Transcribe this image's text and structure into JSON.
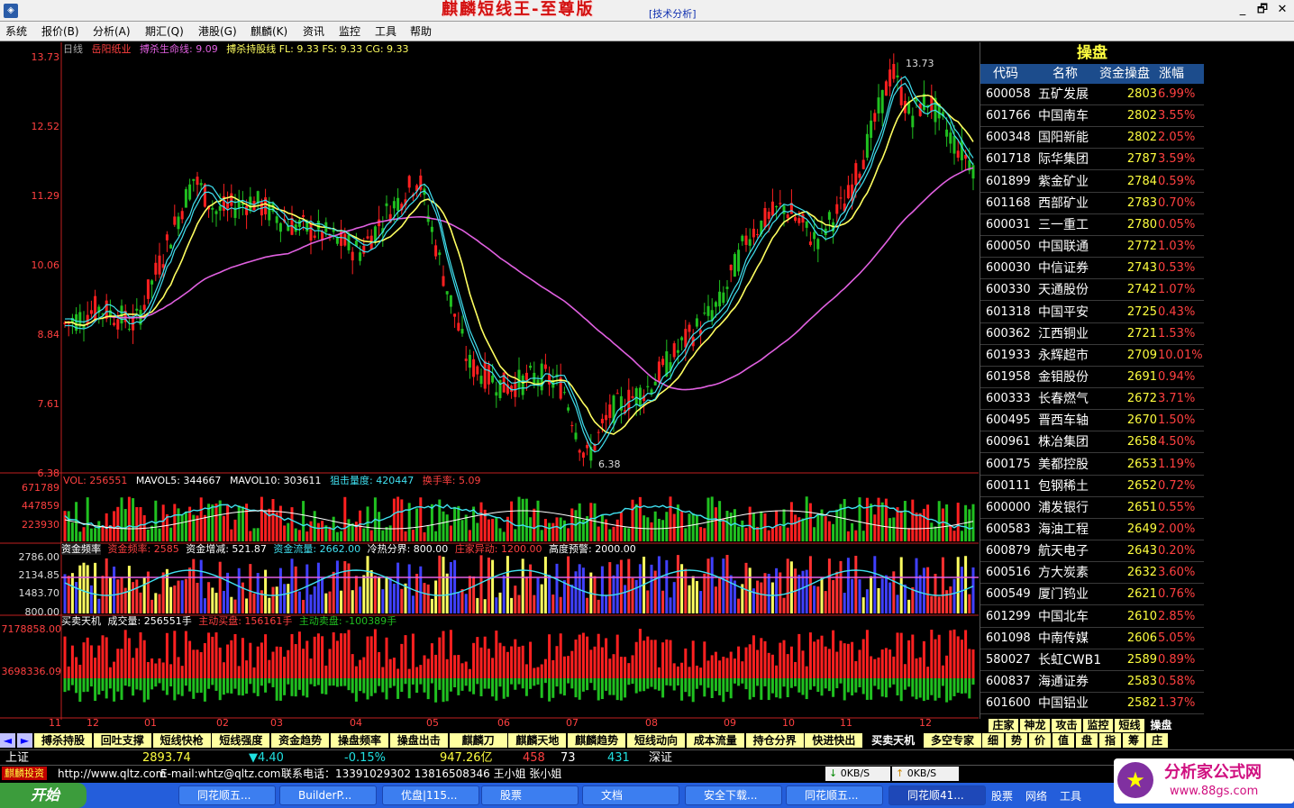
{
  "window": {
    "title": "麒麟短线王-至尊版",
    "subtitle": "[技术分析]",
    "minimize": "_",
    "restore": "🗗",
    "close": "✕"
  },
  "menu": [
    "系统",
    "报价(B)",
    "分析(A)",
    "期汇(Q)",
    "港股(G)",
    "麒麟(K)",
    "资讯",
    "监控",
    "工具",
    "帮助"
  ],
  "main_chart": {
    "period": "日线",
    "stock": "岳阳纸业",
    "line1": "搏杀生命线: 9.09",
    "line2": "搏杀持股线 FL: 9.33 FS: 9.33 CG: 9.33",
    "y_ticks": [
      "13.73",
      "12.52",
      "11.29",
      "10.06",
      "8.84",
      "7.61",
      "6.38"
    ],
    "high_mark": "13.73",
    "low_mark": "6.38"
  },
  "vol_panel": {
    "vol": "VOL: 256551",
    "mavol5": "MAVOL5: 344667",
    "mavol10": "MAVOL10: 303611",
    "zj": "狙击量度: 420447",
    "hs": "换手率: 5.09",
    "y_ticks": [
      "671789",
      "447859",
      "223930"
    ]
  },
  "fund_panel": {
    "name": "资金频率",
    "v1": "资金频率: 2585",
    "v2": "资金增减: 521.87",
    "v3": "资金流量: 2662.00",
    "v4": "冷热分界: 800.00",
    "v5": "庄家异动: 1200.00",
    "v6": "高度预警: 2000.00",
    "y_ticks": [
      "2786.00",
      "2134.85",
      "1483.70",
      "800.00"
    ]
  },
  "trade_panel": {
    "name": "买卖天机",
    "v1": "成交量: 256551手",
    "v2": "主动买盘: 156161手",
    "v3": "主动卖盘: -100389手",
    "y_ticks": [
      "7178858.00",
      "3698336.09"
    ]
  },
  "x_ticks": [
    "11",
    "12",
    "01",
    "02",
    "03",
    "04",
    "05",
    "06",
    "07",
    "08",
    "09",
    "10",
    "11",
    "12"
  ],
  "right_panel": {
    "title": "操盘",
    "headers": [
      "代码",
      "名称",
      "资金操盘",
      "涨幅"
    ],
    "rows": [
      {
        "code": "600058",
        "name": "五矿发展",
        "val": "2803",
        "pct": "6.99%"
      },
      {
        "code": "601766",
        "name": "中国南车",
        "val": "2802",
        "pct": "3.55%"
      },
      {
        "code": "600348",
        "name": "国阳新能",
        "val": "2802",
        "pct": "2.05%"
      },
      {
        "code": "601718",
        "name": "际华集团",
        "val": "2787",
        "pct": "3.59%"
      },
      {
        "code": "601899",
        "name": "紫金矿业",
        "val": "2784",
        "pct": "0.59%"
      },
      {
        "code": "601168",
        "name": "西部矿业",
        "val": "2783",
        "pct": "0.70%"
      },
      {
        "code": "600031",
        "name": "三一重工",
        "val": "2780",
        "pct": "0.05%"
      },
      {
        "code": "600050",
        "name": "中国联通",
        "val": "2772",
        "pct": "1.03%"
      },
      {
        "code": "600030",
        "name": "中信证券",
        "val": "2743",
        "pct": "0.53%"
      },
      {
        "code": "600330",
        "name": "天通股份",
        "val": "2742",
        "pct": "1.07%"
      },
      {
        "code": "601318",
        "name": "中国平安",
        "val": "2725",
        "pct": "0.43%"
      },
      {
        "code": "600362",
        "name": "江西铜业",
        "val": "2721",
        "pct": "1.53%"
      },
      {
        "code": "601933",
        "name": "永辉超市",
        "val": "2709",
        "pct": "10.01%"
      },
      {
        "code": "601958",
        "name": "金钼股份",
        "val": "2691",
        "pct": "0.94%"
      },
      {
        "code": "600333",
        "name": "长春燃气",
        "val": "2672",
        "pct": "3.71%"
      },
      {
        "code": "600495",
        "name": "晋西车轴",
        "val": "2670",
        "pct": "1.50%"
      },
      {
        "code": "600961",
        "name": "株冶集团",
        "val": "2658",
        "pct": "4.50%"
      },
      {
        "code": "600175",
        "name": "美都控股",
        "val": "2653",
        "pct": "1.19%"
      },
      {
        "code": "600111",
        "name": "包钢稀土",
        "val": "2652",
        "pct": "0.72%"
      },
      {
        "code": "600000",
        "name": "浦发银行",
        "val": "2651",
        "pct": "0.55%"
      },
      {
        "code": "600583",
        "name": "海油工程",
        "val": "2649",
        "pct": "2.00%"
      },
      {
        "code": "600879",
        "name": "航天电子",
        "val": "2643",
        "pct": "0.20%"
      },
      {
        "code": "600516",
        "name": "方大炭素",
        "val": "2632",
        "pct": "3.60%"
      },
      {
        "code": "600549",
        "name": "厦门钨业",
        "val": "2621",
        "pct": "0.76%"
      },
      {
        "code": "601299",
        "name": "中国北车",
        "val": "2610",
        "pct": "2.85%"
      },
      {
        "code": "601098",
        "name": "中南传媒",
        "val": "2606",
        "pct": "5.05%"
      },
      {
        "code": "580027",
        "name": "长虹CWB1",
        "val": "2589",
        "pct": "0.89%"
      },
      {
        "code": "600837",
        "name": "海通证券",
        "val": "2583",
        "pct": "0.58%"
      },
      {
        "code": "601600",
        "name": "中国铝业",
        "val": "2582",
        "pct": "1.37%"
      }
    ],
    "side_tabs_row1": [
      "庄家",
      "神龙",
      "攻击",
      "监控",
      "短线",
      "操盘"
    ],
    "side_tabs_row2": [
      "细",
      "势",
      "价",
      "值",
      "盘",
      "指",
      "筹",
      "庄"
    ]
  },
  "bottom_tabs": [
    "搏杀持股",
    "回吐支撑",
    "短线快枪",
    "短线强度",
    "资金趋势",
    "操盘频率",
    "操盘出击",
    "麒麟刀",
    "麒麟天地",
    "麒麟趋势",
    "短线动向",
    "成本流量",
    "持仓分界",
    "快进快出",
    "买卖天机",
    "多空专家"
  ],
  "status": {
    "index_name": "上证",
    "index_val": "2893.74",
    "chg": "▼4.40",
    "pct": "-0.15%",
    "amount": "947.26亿",
    "up": "458",
    "flat": "73",
    "down": "431",
    "index2": "深证"
  },
  "status2": {
    "site": "http://www.qltz.com",
    "email": "E-mail:whtz@qltz.com",
    "phone": "联系电话：13391029302 13816508346 王小姐 张小姐",
    "down_speed": "0KB/S",
    "up_speed": "0KB/S"
  },
  "taskbar": {
    "start": "开始",
    "tasks": [
      "同花顺五...",
      "BuilderP...",
      "优盘|115...",
      "股票",
      "文档",
      "安全下载...",
      "同花顺五...",
      "同花顺41..."
    ],
    "tray": [
      "股票",
      "网络",
      "工具"
    ]
  },
  "watermark": {
    "text": "分析家公式网",
    "url": "www.88gs.com"
  },
  "colors": {
    "up": "#ff2020",
    "down": "#20c020",
    "ma_yellow": "#ffff60",
    "ma_cyan": "#40e0f0",
    "ma_pink": "#e060e0"
  }
}
